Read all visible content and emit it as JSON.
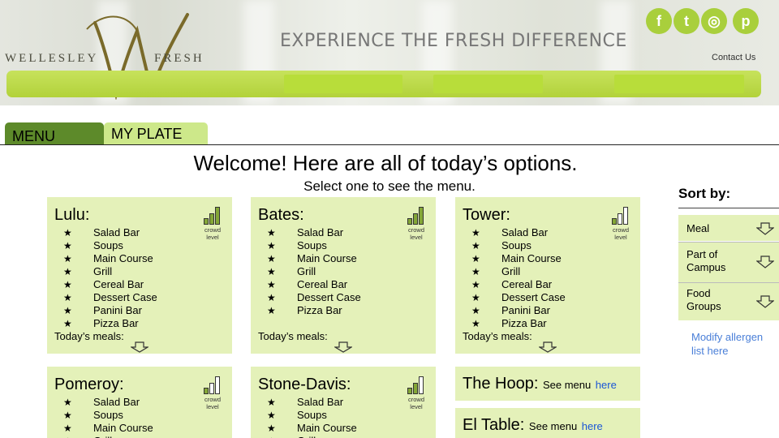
{
  "header": {
    "logo_left": "WELLESLEY",
    "logo_right": "FRESH",
    "tagline": "EXPERIENCE THE FRESH DIFFERENCE",
    "contact": "Contact Us",
    "social": [
      {
        "name": "facebook-icon",
        "glyph": "f"
      },
      {
        "name": "twitter-icon",
        "glyph": "t"
      },
      {
        "name": "instagram-icon",
        "glyph": "◎"
      },
      {
        "name": "pinterest-icon",
        "glyph": "p"
      }
    ],
    "accent_color": "#b2d23a"
  },
  "tabs": {
    "menu": "MENU",
    "my_plate": "MY PLATE"
  },
  "welcome": "Welcome! Here are all of today’s options.",
  "subtitle": "Select one to see the menu.",
  "crowd_label": "crowd level",
  "todays_meals": "Today’s meals:",
  "halls": [
    {
      "name": "Lulu:",
      "crowd_level": 3,
      "items": [
        "Salad Bar",
        "Soups",
        "Main Course",
        "Grill",
        "Cereal Bar",
        "Dessert Case",
        "Panini Bar",
        "Pizza Bar"
      ]
    },
    {
      "name": "Bates:",
      "crowd_level": 3,
      "items": [
        "Salad Bar",
        "Soups",
        "Main Course",
        "Grill",
        "Cereal Bar",
        "Dessert Case",
        "Pizza Bar"
      ]
    },
    {
      "name": "Tower:",
      "crowd_level": 1,
      "items": [
        "Salad Bar",
        "Soups",
        "Main Course",
        "Grill",
        "Cereal Bar",
        "Dessert Case",
        "Panini Bar",
        "Pizza Bar"
      ]
    },
    {
      "name": "Pomeroy:",
      "crowd_level": 1,
      "items": [
        "Salad Bar",
        "Soups",
        "Main Course",
        "Grill"
      ]
    },
    {
      "name": "Stone-Davis:",
      "crowd_level": 2,
      "items": [
        "Salad Bar",
        "Soups",
        "Main Course",
        "Grill"
      ]
    }
  ],
  "others": [
    {
      "name": "The Hoop:",
      "see": "See menu",
      "link": "here"
    },
    {
      "name": "El Table:",
      "see": "See menu",
      "link": "here"
    }
  ],
  "sort": {
    "title": "Sort by:",
    "options": [
      "Meal",
      "Part of Campus",
      "Food Groups"
    ],
    "allergen_link": "Modify allergen list here"
  }
}
